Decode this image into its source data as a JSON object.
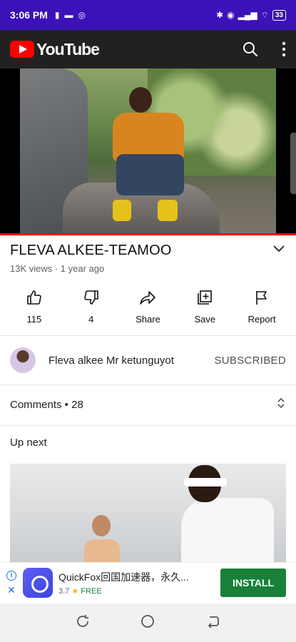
{
  "statusbar": {
    "time": "3:06 PM",
    "battery": "33"
  },
  "app": {
    "brand": "YouTube"
  },
  "video": {
    "title": "FLEVA ALKEE-TEAMOO",
    "meta": "13K views · 1 year ago"
  },
  "actions": [
    {
      "label": "115",
      "icon": "thumbs-up-icon"
    },
    {
      "label": "4",
      "icon": "thumbs-down-icon"
    },
    {
      "label": "Share",
      "icon": "share-icon"
    },
    {
      "label": "Save",
      "icon": "add-to-playlist-icon"
    },
    {
      "label": "Report",
      "icon": "flag-icon"
    }
  ],
  "channel": {
    "name": "Fleva alkee Mr ketunguyot",
    "subscribe_state": "SUBSCRIBED"
  },
  "comments": {
    "label": "Comments • 28"
  },
  "upnext": {
    "label": "Up next"
  },
  "ad": {
    "title": "QuickFox回国加速器，永久...",
    "rating": "3.7",
    "star": "★",
    "price": "FREE",
    "cta": "INSTALL"
  },
  "colors": {
    "statusbar": "#3a12b8",
    "topbar": "#212121",
    "brand_red": "#ff0000",
    "install_green": "#188038"
  }
}
